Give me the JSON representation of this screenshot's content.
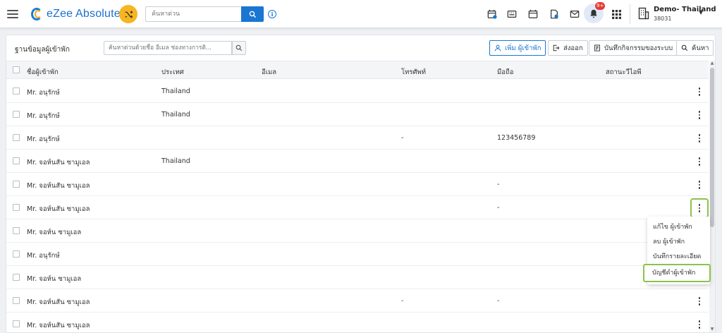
{
  "header": {
    "app_name": "eZee Absolute",
    "search_placeholder": "ค้นหาด่วน",
    "info_label": "i",
    "notifications_badge": "9+",
    "property_name": "Demo- Thailand",
    "property_id": "38031",
    "caret": "▼"
  },
  "toolbar": {
    "title": "ฐานข้อมูลผู้เข้าพัก",
    "search_placeholder": "ค้นหาด่วนด้วยชื่อ อีเมล ช่องทางการติ...",
    "add_guest": "เพิ่ม ผู้เข้าพัก",
    "export": "ส่งออก",
    "audit_log": "บันทึกกิจกรรมของระบบ",
    "search": "ค้นหา"
  },
  "table": {
    "columns": [
      "ชื่อผู้เข้าพัก",
      "ประเทศ",
      "อีเมล",
      "โทรศัพท์",
      "มือถือ",
      "สถานะวีไอพี"
    ],
    "rows": [
      {
        "name": "Mr. อนุรักษ์",
        "country": "Thailand",
        "email": "",
        "phone": "",
        "mobile": "",
        "vip": ""
      },
      {
        "name": "Mr. อนุรักษ์",
        "country": "Thailand",
        "email": "",
        "phone": "",
        "mobile": "",
        "vip": ""
      },
      {
        "name": "Mr. อนุรักษ์",
        "country": "",
        "email": "",
        "phone": "-",
        "mobile": "123456789",
        "vip": ""
      },
      {
        "name": "Mr. จอห์นสัน ซามูเอล",
        "country": "Thailand",
        "email": "",
        "phone": "",
        "mobile": "",
        "vip": ""
      },
      {
        "name": "Mr. จอห์นสัน ซามูเอล",
        "country": "",
        "email": "",
        "phone": "",
        "mobile": "-",
        "vip": ""
      },
      {
        "name": "Mr. จอห์นสัน ซามูเอล",
        "country": "",
        "email": "",
        "phone": "",
        "mobile": "-",
        "vip": ""
      },
      {
        "name": "Mr. จอห์น ซามูเอล",
        "country": "",
        "email": "",
        "phone": "",
        "mobile": "",
        "vip": ""
      },
      {
        "name": "Mr. อนุรักษ์",
        "country": "",
        "email": "",
        "phone": "",
        "mobile": "",
        "vip": ""
      },
      {
        "name": "Mr. จอห์น ซามูเอล",
        "country": "",
        "email": "",
        "phone": "",
        "mobile": "",
        "vip": ""
      },
      {
        "name": "Mr. จอห์นสัน ซามูเอล",
        "country": "",
        "email": "",
        "phone": "-",
        "mobile": "-",
        "vip": ""
      },
      {
        "name": "Mr. จอห์นสัน ซามูเอล",
        "country": "",
        "email": "",
        "phone": "",
        "mobile": "",
        "vip": ""
      }
    ]
  },
  "row_menu": {
    "items": [
      "แก้ไข ผู้เข้าพัก",
      "ลบ ผู้เข้าพัก",
      "บันทึกรายละเอียด",
      "บัญชีดำผู้เข้าพัก"
    ]
  },
  "colors": {
    "brand_blue": "#1976d2",
    "accent_yellow": "#f6b521",
    "highlight_green": "#8bc34a",
    "badge_red": "#e53935"
  },
  "icons": {
    "menu": "hamburger-icon",
    "shuffle": "shuffle-icon",
    "search": "search-icon",
    "info": "info-icon",
    "calendar_edit": "calendar-edit-icon",
    "keyboard": "keyboard-icon",
    "calendar": "calendar-icon",
    "document": "document-icon",
    "mail": "mail-icon",
    "bell": "bell-icon",
    "apps": "apps-grid-icon",
    "building": "building-icon",
    "user": "user-icon",
    "export": "export-icon",
    "log": "log-icon",
    "kebab": "kebab-menu-icon"
  }
}
